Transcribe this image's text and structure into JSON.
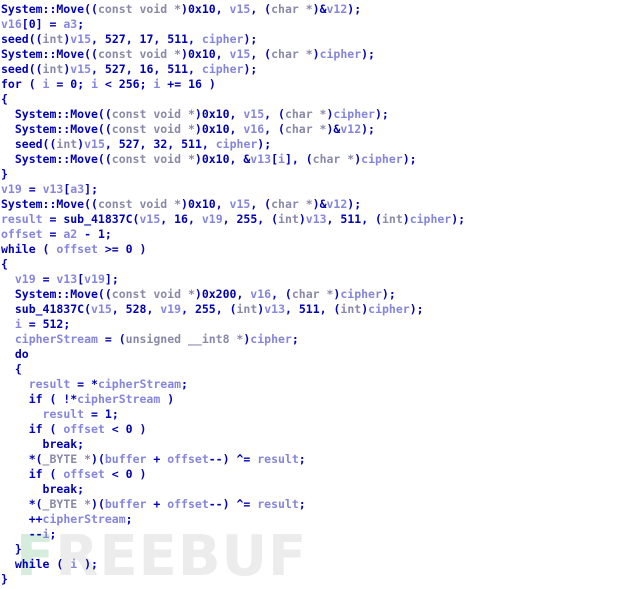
{
  "app": {
    "view_name": "pseudocode-listing",
    "background_color": "#ffffff"
  },
  "watermark": {
    "first_letter": "F",
    "rest": "REEBUF",
    "first_letter_color": "#d6ecdc",
    "rest_color": "#ececec"
  },
  "colors": {
    "keyword": "#0000b4",
    "function": "#0000b4",
    "number": "#0000b4",
    "type_cast": "#8a8aa8",
    "local_variable": "#8585dc",
    "background": "#ffffff"
  },
  "code": {
    "language": "c-pseudocode",
    "lines": [
      [
        {
          "t": "System::Move((",
          "c": "kw"
        },
        {
          "t": "const void *",
          "c": "type"
        },
        {
          "t": ")",
          "c": "kw"
        },
        {
          "t": "0x10",
          "c": "num"
        },
        {
          "t": ", ",
          "c": "kw"
        },
        {
          "t": "v15",
          "c": "var"
        },
        {
          "t": ", (",
          "c": "kw"
        },
        {
          "t": "char *",
          "c": "type"
        },
        {
          "t": ")&",
          "c": "kw"
        },
        {
          "t": "v12",
          "c": "var"
        },
        {
          "t": ");",
          "c": "kw"
        }
      ],
      [
        {
          "t": "v16",
          "c": "var"
        },
        {
          "t": "[",
          "c": "kw"
        },
        {
          "t": "0",
          "c": "num"
        },
        {
          "t": "] = ",
          "c": "kw"
        },
        {
          "t": "a3",
          "c": "var"
        },
        {
          "t": ";",
          "c": "kw"
        }
      ],
      [
        {
          "t": "seed((",
          "c": "kw"
        },
        {
          "t": "int",
          "c": "type"
        },
        {
          "t": ")",
          "c": "kw"
        },
        {
          "t": "v15",
          "c": "var"
        },
        {
          "t": ", ",
          "c": "kw"
        },
        {
          "t": "527",
          "c": "num"
        },
        {
          "t": ", ",
          "c": "kw"
        },
        {
          "t": "17",
          "c": "num"
        },
        {
          "t": ", ",
          "c": "kw"
        },
        {
          "t": "511",
          "c": "num"
        },
        {
          "t": ", ",
          "c": "kw"
        },
        {
          "t": "cipher",
          "c": "var"
        },
        {
          "t": ");",
          "c": "kw"
        }
      ],
      [
        {
          "t": "System::Move((",
          "c": "kw"
        },
        {
          "t": "const void *",
          "c": "type"
        },
        {
          "t": ")",
          "c": "kw"
        },
        {
          "t": "0x10",
          "c": "num"
        },
        {
          "t": ", ",
          "c": "kw"
        },
        {
          "t": "v15",
          "c": "var"
        },
        {
          "t": ", (",
          "c": "kw"
        },
        {
          "t": "char *",
          "c": "type"
        },
        {
          "t": ")",
          "c": "kw"
        },
        {
          "t": "cipher",
          "c": "var"
        },
        {
          "t": ");",
          "c": "kw"
        }
      ],
      [
        {
          "t": "seed((",
          "c": "kw"
        },
        {
          "t": "int",
          "c": "type"
        },
        {
          "t": ")",
          "c": "kw"
        },
        {
          "t": "v15",
          "c": "var"
        },
        {
          "t": ", ",
          "c": "kw"
        },
        {
          "t": "527",
          "c": "num"
        },
        {
          "t": ", ",
          "c": "kw"
        },
        {
          "t": "16",
          "c": "num"
        },
        {
          "t": ", ",
          "c": "kw"
        },
        {
          "t": "511",
          "c": "num"
        },
        {
          "t": ", ",
          "c": "kw"
        },
        {
          "t": "cipher",
          "c": "var"
        },
        {
          "t": ");",
          "c": "kw"
        }
      ],
      [
        {
          "t": "for ( ",
          "c": "kw"
        },
        {
          "t": "i",
          "c": "var"
        },
        {
          "t": " = ",
          "c": "kw"
        },
        {
          "t": "0",
          "c": "num"
        },
        {
          "t": "; ",
          "c": "kw"
        },
        {
          "t": "i",
          "c": "var"
        },
        {
          "t": " < ",
          "c": "kw"
        },
        {
          "t": "256",
          "c": "num"
        },
        {
          "t": "; ",
          "c": "kw"
        },
        {
          "t": "i",
          "c": "var"
        },
        {
          "t": " += ",
          "c": "kw"
        },
        {
          "t": "16",
          "c": "num"
        },
        {
          "t": " )",
          "c": "kw"
        }
      ],
      [
        {
          "t": "{",
          "c": "kw"
        }
      ],
      [
        {
          "t": "  System::Move((",
          "c": "kw"
        },
        {
          "t": "const void *",
          "c": "type"
        },
        {
          "t": ")",
          "c": "kw"
        },
        {
          "t": "0x10",
          "c": "num"
        },
        {
          "t": ", ",
          "c": "kw"
        },
        {
          "t": "v15",
          "c": "var"
        },
        {
          "t": ", (",
          "c": "kw"
        },
        {
          "t": "char *",
          "c": "type"
        },
        {
          "t": ")",
          "c": "kw"
        },
        {
          "t": "cipher",
          "c": "var"
        },
        {
          "t": ");",
          "c": "kw"
        }
      ],
      [
        {
          "t": "  System::Move((",
          "c": "kw"
        },
        {
          "t": "const void *",
          "c": "type"
        },
        {
          "t": ")",
          "c": "kw"
        },
        {
          "t": "0x10",
          "c": "num"
        },
        {
          "t": ", ",
          "c": "kw"
        },
        {
          "t": "v16",
          "c": "var"
        },
        {
          "t": ", (",
          "c": "kw"
        },
        {
          "t": "char *",
          "c": "type"
        },
        {
          "t": ")&",
          "c": "kw"
        },
        {
          "t": "v12",
          "c": "var"
        },
        {
          "t": ");",
          "c": "kw"
        }
      ],
      [
        {
          "t": "  seed((",
          "c": "kw"
        },
        {
          "t": "int",
          "c": "type"
        },
        {
          "t": ")",
          "c": "kw"
        },
        {
          "t": "v15",
          "c": "var"
        },
        {
          "t": ", ",
          "c": "kw"
        },
        {
          "t": "527",
          "c": "num"
        },
        {
          "t": ", ",
          "c": "kw"
        },
        {
          "t": "32",
          "c": "num"
        },
        {
          "t": ", ",
          "c": "kw"
        },
        {
          "t": "511",
          "c": "num"
        },
        {
          "t": ", ",
          "c": "kw"
        },
        {
          "t": "cipher",
          "c": "var"
        },
        {
          "t": ");",
          "c": "kw"
        }
      ],
      [
        {
          "t": "  System::Move((",
          "c": "kw"
        },
        {
          "t": "const void *",
          "c": "type"
        },
        {
          "t": ")",
          "c": "kw"
        },
        {
          "t": "0x10",
          "c": "num"
        },
        {
          "t": ", &",
          "c": "kw"
        },
        {
          "t": "v13",
          "c": "var"
        },
        {
          "t": "[",
          "c": "kw"
        },
        {
          "t": "i",
          "c": "var"
        },
        {
          "t": "], (",
          "c": "kw"
        },
        {
          "t": "char *",
          "c": "type"
        },
        {
          "t": ")",
          "c": "kw"
        },
        {
          "t": "cipher",
          "c": "var"
        },
        {
          "t": ");",
          "c": "kw"
        }
      ],
      [
        {
          "t": "}",
          "c": "kw"
        }
      ],
      [
        {
          "t": "v19",
          "c": "var"
        },
        {
          "t": " = ",
          "c": "kw"
        },
        {
          "t": "v13",
          "c": "var"
        },
        {
          "t": "[",
          "c": "kw"
        },
        {
          "t": "a3",
          "c": "var"
        },
        {
          "t": "];",
          "c": "kw"
        }
      ],
      [
        {
          "t": "System::Move((",
          "c": "kw"
        },
        {
          "t": "const void *",
          "c": "type"
        },
        {
          "t": ")",
          "c": "kw"
        },
        {
          "t": "0x10",
          "c": "num"
        },
        {
          "t": ", ",
          "c": "kw"
        },
        {
          "t": "v15",
          "c": "var"
        },
        {
          "t": ", (",
          "c": "kw"
        },
        {
          "t": "char *",
          "c": "type"
        },
        {
          "t": ")&",
          "c": "kw"
        },
        {
          "t": "v12",
          "c": "var"
        },
        {
          "t": ");",
          "c": "kw"
        }
      ],
      [
        {
          "t": "result",
          "c": "var"
        },
        {
          "t": " = sub_41837C(",
          "c": "kw"
        },
        {
          "t": "v15",
          "c": "var"
        },
        {
          "t": ", ",
          "c": "kw"
        },
        {
          "t": "16",
          "c": "num"
        },
        {
          "t": ", ",
          "c": "kw"
        },
        {
          "t": "v19",
          "c": "var"
        },
        {
          "t": ", ",
          "c": "kw"
        },
        {
          "t": "255",
          "c": "num"
        },
        {
          "t": ", (",
          "c": "kw"
        },
        {
          "t": "int",
          "c": "type"
        },
        {
          "t": ")",
          "c": "kw"
        },
        {
          "t": "v13",
          "c": "var"
        },
        {
          "t": ", ",
          "c": "kw"
        },
        {
          "t": "511",
          "c": "num"
        },
        {
          "t": ", (",
          "c": "kw"
        },
        {
          "t": "int",
          "c": "type"
        },
        {
          "t": ")",
          "c": "kw"
        },
        {
          "t": "cipher",
          "c": "var"
        },
        {
          "t": ");",
          "c": "kw"
        }
      ],
      [
        {
          "t": "offset",
          "c": "var"
        },
        {
          "t": " = ",
          "c": "kw"
        },
        {
          "t": "a2",
          "c": "var"
        },
        {
          "t": " - ",
          "c": "kw"
        },
        {
          "t": "1",
          "c": "num"
        },
        {
          "t": ";",
          "c": "kw"
        }
      ],
      [
        {
          "t": "while ( ",
          "c": "kw"
        },
        {
          "t": "offset",
          "c": "var"
        },
        {
          "t": " >= ",
          "c": "kw"
        },
        {
          "t": "0",
          "c": "num"
        },
        {
          "t": " )",
          "c": "kw"
        }
      ],
      [
        {
          "t": "{",
          "c": "kw"
        }
      ],
      [
        {
          "t": "  ",
          "c": "kw"
        },
        {
          "t": "v19",
          "c": "var"
        },
        {
          "t": " = ",
          "c": "kw"
        },
        {
          "t": "v13",
          "c": "var"
        },
        {
          "t": "[",
          "c": "kw"
        },
        {
          "t": "v19",
          "c": "var"
        },
        {
          "t": "];",
          "c": "kw"
        }
      ],
      [
        {
          "t": "  System::Move((",
          "c": "kw"
        },
        {
          "t": "const void *",
          "c": "type"
        },
        {
          "t": ")",
          "c": "kw"
        },
        {
          "t": "0x200",
          "c": "num"
        },
        {
          "t": ", ",
          "c": "kw"
        },
        {
          "t": "v16",
          "c": "var"
        },
        {
          "t": ", (",
          "c": "kw"
        },
        {
          "t": "char *",
          "c": "type"
        },
        {
          "t": ")",
          "c": "kw"
        },
        {
          "t": "cipher",
          "c": "var"
        },
        {
          "t": ");",
          "c": "kw"
        }
      ],
      [
        {
          "t": "  sub_41837C(",
          "c": "kw"
        },
        {
          "t": "v15",
          "c": "var"
        },
        {
          "t": ", ",
          "c": "kw"
        },
        {
          "t": "528",
          "c": "num"
        },
        {
          "t": ", ",
          "c": "kw"
        },
        {
          "t": "v19",
          "c": "var"
        },
        {
          "t": ", ",
          "c": "kw"
        },
        {
          "t": "255",
          "c": "num"
        },
        {
          "t": ", (",
          "c": "kw"
        },
        {
          "t": "int",
          "c": "type"
        },
        {
          "t": ")",
          "c": "kw"
        },
        {
          "t": "v13",
          "c": "var"
        },
        {
          "t": ", ",
          "c": "kw"
        },
        {
          "t": "511",
          "c": "num"
        },
        {
          "t": ", (",
          "c": "kw"
        },
        {
          "t": "int",
          "c": "type"
        },
        {
          "t": ")",
          "c": "kw"
        },
        {
          "t": "cipher",
          "c": "var"
        },
        {
          "t": ");",
          "c": "kw"
        }
      ],
      [
        {
          "t": "  ",
          "c": "kw"
        },
        {
          "t": "i",
          "c": "var"
        },
        {
          "t": " = ",
          "c": "kw"
        },
        {
          "t": "512",
          "c": "num"
        },
        {
          "t": ";",
          "c": "kw"
        }
      ],
      [
        {
          "t": "  ",
          "c": "kw"
        },
        {
          "t": "cipherStream",
          "c": "var"
        },
        {
          "t": " = (",
          "c": "kw"
        },
        {
          "t": "unsigned __int8 *",
          "c": "type"
        },
        {
          "t": ")",
          "c": "kw"
        },
        {
          "t": "cipher",
          "c": "var"
        },
        {
          "t": ";",
          "c": "kw"
        }
      ],
      [
        {
          "t": "  do",
          "c": "kw"
        }
      ],
      [
        {
          "t": "  {",
          "c": "kw"
        }
      ],
      [
        {
          "t": "    ",
          "c": "kw"
        },
        {
          "t": "result",
          "c": "var"
        },
        {
          "t": " = *",
          "c": "kw"
        },
        {
          "t": "cipherStream",
          "c": "var"
        },
        {
          "t": ";",
          "c": "kw"
        }
      ],
      [
        {
          "t": "    if ( !*",
          "c": "kw"
        },
        {
          "t": "cipherStream",
          "c": "var"
        },
        {
          "t": " )",
          "c": "kw"
        }
      ],
      [
        {
          "t": "      ",
          "c": "kw"
        },
        {
          "t": "result",
          "c": "var"
        },
        {
          "t": " = ",
          "c": "kw"
        },
        {
          "t": "1",
          "c": "num"
        },
        {
          "t": ";",
          "c": "kw"
        }
      ],
      [
        {
          "t": "    if ( ",
          "c": "kw"
        },
        {
          "t": "offset",
          "c": "var"
        },
        {
          "t": " < ",
          "c": "kw"
        },
        {
          "t": "0",
          "c": "num"
        },
        {
          "t": " )",
          "c": "kw"
        }
      ],
      [
        {
          "t": "      break;",
          "c": "kw"
        }
      ],
      [
        {
          "t": "    *(",
          "c": "kw"
        },
        {
          "t": "_BYTE *",
          "c": "type"
        },
        {
          "t": ")(",
          "c": "kw"
        },
        {
          "t": "buffer",
          "c": "var"
        },
        {
          "t": " + ",
          "c": "kw"
        },
        {
          "t": "offset",
          "c": "var"
        },
        {
          "t": "--) ^= ",
          "c": "kw"
        },
        {
          "t": "result",
          "c": "var"
        },
        {
          "t": ";",
          "c": "kw"
        }
      ],
      [
        {
          "t": "    if ( ",
          "c": "kw"
        },
        {
          "t": "offset",
          "c": "var"
        },
        {
          "t": " < ",
          "c": "kw"
        },
        {
          "t": "0",
          "c": "num"
        },
        {
          "t": " )",
          "c": "kw"
        }
      ],
      [
        {
          "t": "      break;",
          "c": "kw"
        }
      ],
      [
        {
          "t": "    *(",
          "c": "kw"
        },
        {
          "t": "_BYTE *",
          "c": "type"
        },
        {
          "t": ")(",
          "c": "kw"
        },
        {
          "t": "buffer",
          "c": "var"
        },
        {
          "t": " + ",
          "c": "kw"
        },
        {
          "t": "offset",
          "c": "var"
        },
        {
          "t": "--) ^= ",
          "c": "kw"
        },
        {
          "t": "result",
          "c": "var"
        },
        {
          "t": ";",
          "c": "kw"
        }
      ],
      [
        {
          "t": "    ++",
          "c": "kw"
        },
        {
          "t": "cipherStream",
          "c": "var"
        },
        {
          "t": ";",
          "c": "kw"
        }
      ],
      [
        {
          "t": "    --",
          "c": "kw"
        },
        {
          "t": "i",
          "c": "var"
        },
        {
          "t": ";",
          "c": "kw"
        }
      ],
      [
        {
          "t": "  }",
          "c": "kw"
        }
      ],
      [
        {
          "t": "  while ( ",
          "c": "kw"
        },
        {
          "t": "i",
          "c": "var"
        },
        {
          "t": " );",
          "c": "kw"
        }
      ],
      [
        {
          "t": "}",
          "c": "kw"
        }
      ]
    ]
  }
}
